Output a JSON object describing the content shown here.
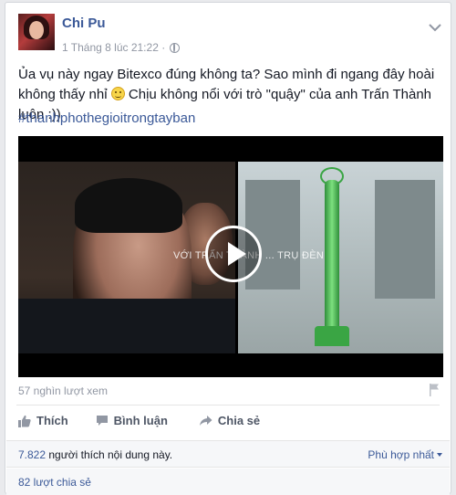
{
  "post": {
    "author": "Chi Pu",
    "timestamp": "1 Tháng 8 lúc 21:22 ·",
    "text_part1": "Ủa vụ này ngay Bitexco đúng không ta? Sao mình đi ngang đây hoài không thấy nhỉ ",
    "text_part2": " Chịu không nổi với trò \"quậy\" của anh Trấn Thành luôn :))",
    "hashtag": "#thanhphothegioitrongtayban"
  },
  "video": {
    "caption": "VỚI TRẤN THÀNH ... TRỤ ĐÈN",
    "views": "57 nghìn lượt xem"
  },
  "actions": {
    "like": "Thích",
    "comment": "Bình luận",
    "share": "Chia sẻ"
  },
  "reactions": {
    "likes_count": "7.822",
    "likes_suffix": " người thích nội dung này.",
    "sort_label": "Phù hợp nhất",
    "shares": "82 lượt chia sẻ"
  },
  "icons": [
    "globe-icon",
    "chevron-down-icon",
    "play-icon",
    "flag-icon",
    "like-icon",
    "comment-icon",
    "share-icon",
    "smiley-icon"
  ],
  "colors": {
    "link": "#3b5998",
    "muted": "#9197a3",
    "background": "#e9eaed"
  }
}
